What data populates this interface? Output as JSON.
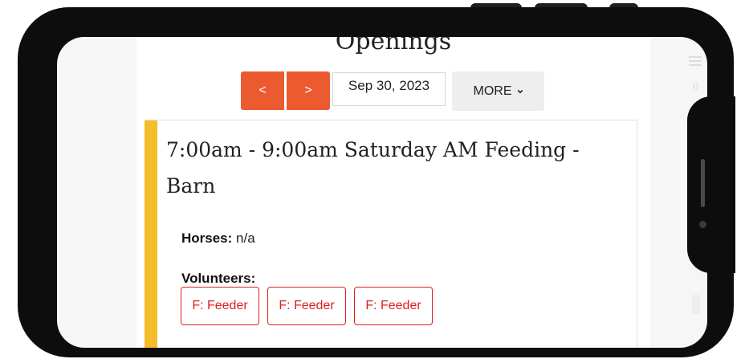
{
  "header": {
    "title": "Openings"
  },
  "nav": {
    "prev_label": "<",
    "next_label": ">",
    "date_value": "Sep 30, 2023",
    "more_label": "MORE"
  },
  "shift": {
    "title": "7:00am - 9:00am Saturday AM Feeding - Barn",
    "horses_label": "Horses:",
    "horses_value": "n/a",
    "volunteers_label": "Volunteers:",
    "volunteer_slots": [
      "F: Feeder",
      "F: Feeder",
      "F: Feeder"
    ]
  },
  "colors": {
    "nav_button": "#ec5b30",
    "card_accent": "#f5bd29",
    "slot_border": "#e11d1d"
  }
}
